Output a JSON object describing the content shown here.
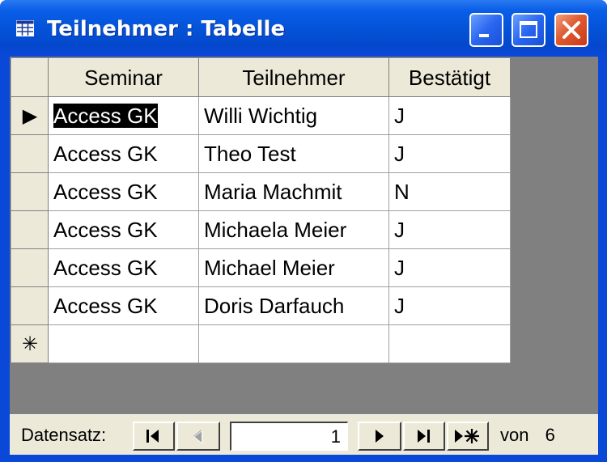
{
  "window": {
    "title": "Teilnehmer : Tabelle",
    "icons": {
      "app": "table-icon",
      "minimize": "minimize-icon",
      "maximize": "maximize-icon",
      "close": "close-icon"
    }
  },
  "table": {
    "columns": [
      "Seminar",
      "Teilnehmer",
      "Bestätigt"
    ],
    "rows": [
      {
        "seminar": "Access GK",
        "teilnehmer": "Willi Wichtig",
        "bestaetigt": "J"
      },
      {
        "seminar": "Access GK",
        "teilnehmer": "Theo Test",
        "bestaetigt": "J"
      },
      {
        "seminar": "Access GK",
        "teilnehmer": "Maria Machmit",
        "bestaetigt": "N"
      },
      {
        "seminar": "Access GK",
        "teilnehmer": "Michaela Meier",
        "bestaetigt": "J"
      },
      {
        "seminar": "Access GK",
        "teilnehmer": "Michael Meier",
        "bestaetigt": "J"
      },
      {
        "seminar": "Access GK",
        "teilnehmer": "Doris Darfauch",
        "bestaetigt": "J"
      }
    ],
    "current_row_marker": "▶",
    "new_row_marker": "✳"
  },
  "navigation": {
    "label": "Datensatz:",
    "current_record": "1",
    "of_label": "von",
    "total_records": "6",
    "icons": {
      "first": "first-record-icon",
      "previous": "previous-record-icon",
      "next": "next-record-icon",
      "last": "last-record-icon",
      "new": "new-record-icon"
    }
  }
}
